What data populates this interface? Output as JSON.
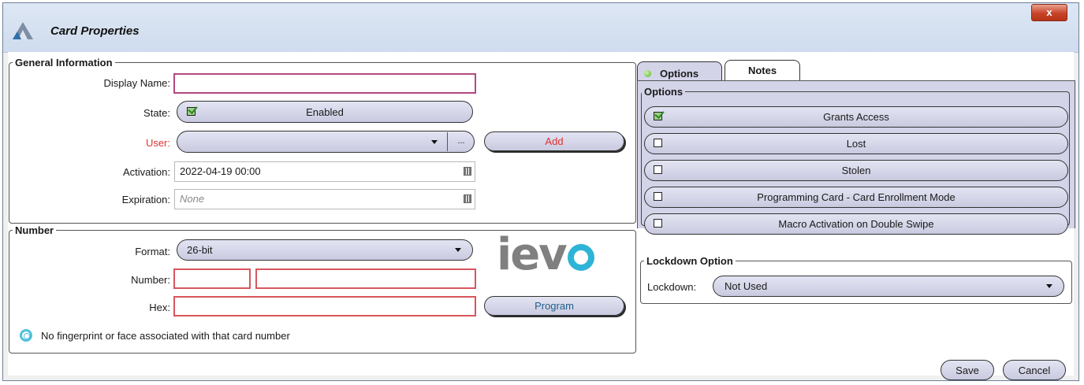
{
  "window": {
    "title": "Card Properties",
    "close_glyph": "x",
    "logo_icon": "app-logo"
  },
  "general": {
    "legend": "General Information",
    "display_name": {
      "label": "Display Name:",
      "value": ""
    },
    "state": {
      "label": "State:",
      "value": "Enabled",
      "checked": true
    },
    "user": {
      "label": "User:",
      "value": "",
      "browse": "...",
      "add_label": "Add"
    },
    "activation": {
      "label": "Activation:",
      "value": "2022-04-19 00:00"
    },
    "expiration": {
      "label": "Expiration:",
      "placeholder": "None"
    }
  },
  "number": {
    "legend": "Number",
    "format": {
      "label": "Format:",
      "value": "26-bit"
    },
    "number": {
      "label": "Number:",
      "facility": "",
      "card": ""
    },
    "hex": {
      "label": "Hex:",
      "value": ""
    },
    "program_label": "Program",
    "brand": "iev",
    "status_text": "No fingerprint or face associated with that card number"
  },
  "tabs": [
    {
      "label": "Options",
      "active": true
    },
    {
      "label": "Notes",
      "active": false
    }
  ],
  "options": {
    "legend": "Options",
    "items": [
      {
        "label": "Grants Access",
        "checked": true
      },
      {
        "label": "Lost",
        "checked": false
      },
      {
        "label": "Stolen",
        "checked": false
      },
      {
        "label": "Programming Card - Card Enrollment Mode",
        "checked": false
      },
      {
        "label": "Macro Activation on Double Swipe",
        "checked": false
      }
    ]
  },
  "lockdown": {
    "legend": "Lockdown Option",
    "label": "Lockdown:",
    "value": "Not Used"
  },
  "footer": {
    "save_label": "Save",
    "cancel_label": "Cancel"
  },
  "colors": {
    "required_border": "#d8565d",
    "required_label": "#e33232",
    "tab_panel": "#d3d4e8",
    "brand_accent": "#2eb4d6"
  }
}
